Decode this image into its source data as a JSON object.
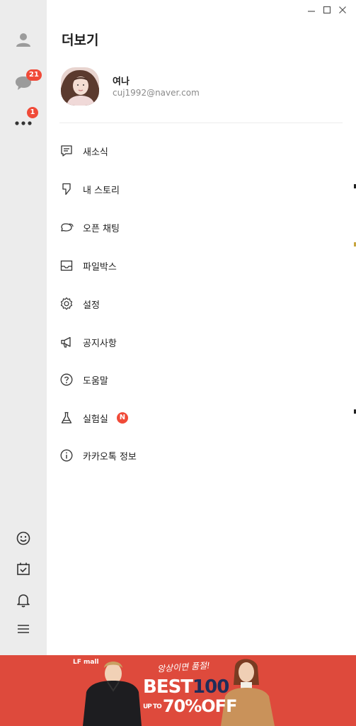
{
  "window": {
    "minimize_label": "Minimize",
    "maximize_label": "Maximize",
    "close_label": "Close"
  },
  "sidebar": {
    "items": [
      {
        "name": "friends",
        "icon": "person-icon"
      },
      {
        "name": "chats",
        "icon": "chat-bubble-icon",
        "badge": "21"
      },
      {
        "name": "more",
        "icon": "more-dots-icon",
        "badge": "1"
      }
    ],
    "bottom": [
      {
        "name": "emoticon",
        "icon": "smiley-icon"
      },
      {
        "name": "calendar",
        "icon": "calendar-check-icon"
      },
      {
        "name": "notifications",
        "icon": "bell-icon"
      },
      {
        "name": "menu",
        "icon": "hamburger-icon"
      }
    ]
  },
  "main": {
    "title": "더보기",
    "profile": {
      "name": "여나",
      "email": "cuj1992@naver.com"
    },
    "menu": [
      {
        "label": "새소식",
        "icon": "news-icon"
      },
      {
        "label": "내 스토리",
        "icon": "story-icon"
      },
      {
        "label": "오픈 채팅",
        "icon": "open-chat-icon"
      },
      {
        "label": "파일박스",
        "icon": "inbox-icon"
      },
      {
        "label": "설정",
        "icon": "gear-icon"
      },
      {
        "label": "공지사항",
        "icon": "megaphone-icon"
      },
      {
        "label": "도움말",
        "icon": "help-icon"
      },
      {
        "label": "실험실",
        "icon": "flask-icon",
        "badge": "N"
      },
      {
        "label": "카카오톡 정보",
        "icon": "info-icon"
      }
    ]
  },
  "banner": {
    "logo": "LF mall",
    "tagline": "앙상이면 품절!",
    "best": "BEST",
    "best_num": "100",
    "upto": "UP TO",
    "off": "70%OFF",
    "colors": {
      "background": "#de4a3c",
      "accent": "#1f2d5a"
    }
  },
  "colors": {
    "sidebar_bg": "#ececec",
    "badge": "#f04a38"
  }
}
